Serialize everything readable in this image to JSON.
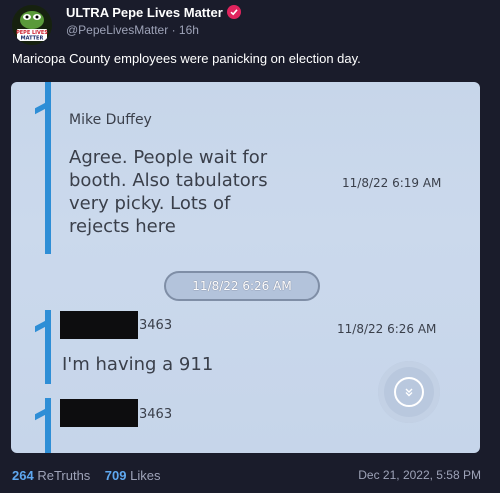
{
  "author": {
    "display_name": "ULTRA Pepe Lives Matter",
    "handle": "@PepeLivesMatter",
    "time_ago": "16h",
    "verified_badge_color": "#e0245e",
    "avatar_text": "PEPE LIVES MATTER"
  },
  "post": {
    "text": "Maricopa County employees were panicking on election day."
  },
  "media": {
    "messages": [
      {
        "sender": "Mike Duffey",
        "body": "Agree. People wait for\nbooth. Also tabulators\nvery picky. Lots of\nrejects here",
        "timestamp": "11/8/22 6:19 AM"
      },
      {
        "sender_suffix": "3463",
        "body": "I'm having a 911",
        "timestamp": "11/8/22 6:26 AM"
      },
      {
        "sender_suffix": "3463"
      }
    ],
    "date_separator": "11/8/22 6:26 AM",
    "scroll_down_icon": "chevron-double-down-icon",
    "accent_bar_color": "#2e8ed6"
  },
  "stats": {
    "retruths_count": "264",
    "retruths_label": "ReTruths",
    "likes_count": "709",
    "likes_label": "Likes"
  },
  "post_date": "Dec 21, 2022, 5:58 PM"
}
